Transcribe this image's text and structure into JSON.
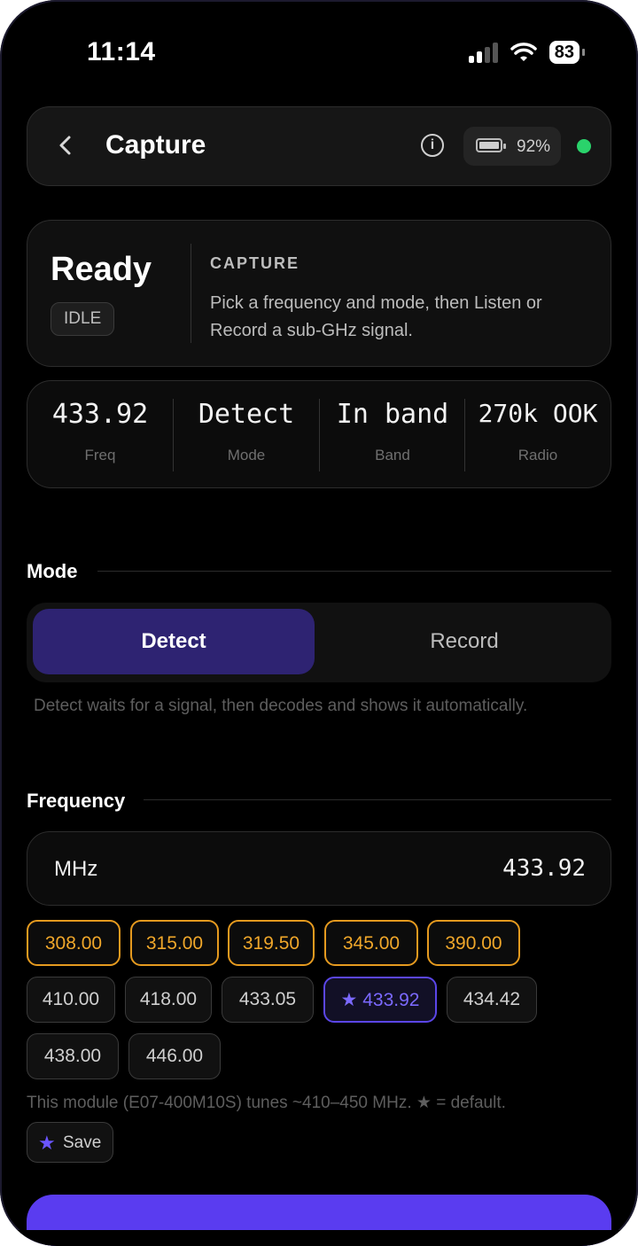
{
  "status_bar": {
    "time": "11:14",
    "battery": "83"
  },
  "header": {
    "title": "Capture",
    "device_battery": "92%"
  },
  "ready_card": {
    "state": "Ready",
    "badge": "IDLE",
    "section_label": "CAPTURE",
    "description": "Pick a frequency and mode, then Listen or Record a sub-GHz signal."
  },
  "stats": [
    {
      "value": "433.92",
      "label": "Freq"
    },
    {
      "value": "Detect",
      "label": "Mode"
    },
    {
      "value": "In band",
      "label": "Band"
    },
    {
      "value": "270k OOK",
      "label": "Radio"
    }
  ],
  "mode": {
    "heading": "Mode",
    "options": [
      "Detect",
      "Record"
    ],
    "selected": "Detect",
    "help": "Detect waits for a signal, then decodes and shows it automatically."
  },
  "frequency": {
    "heading": "Frequency",
    "unit": "MHz",
    "value": "433.92",
    "presets_out_of_range": [
      "308.00",
      "315.00",
      "319.50",
      "345.00",
      "390.00"
    ],
    "presets": [
      "410.00",
      "418.00",
      "433.05",
      "★ 433.92",
      "434.42",
      "438.00",
      "446.00"
    ],
    "selected": "433.92",
    "help": "This module (E07-400M10S) tunes ~410–450 MHz. ★ = default.",
    "save_label": "Save"
  },
  "colors": {
    "accent": "#5a3cf0",
    "warning": "#e59a1f",
    "online": "#2ad36b"
  }
}
